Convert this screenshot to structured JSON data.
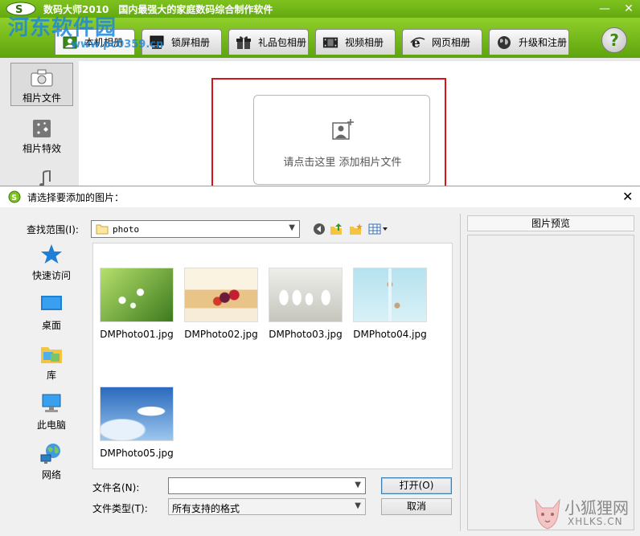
{
  "app": {
    "title": "数码大师2010　国内最强大的家庭数码综合制作软件",
    "minimize": "—",
    "close": "✕",
    "watermark": "河东软件园",
    "watermark_url": "www.pc0359.cn"
  },
  "tabs": [
    {
      "label": "本机相册",
      "icon": "photo-album-icon",
      "active": true
    },
    {
      "label": "锁屏相册",
      "icon": "monitor-icon"
    },
    {
      "label": "礼品包相册",
      "icon": "gift-icon"
    },
    {
      "label": "视频相册",
      "icon": "film-icon"
    },
    {
      "label": "网页相册",
      "icon": "ie-icon"
    },
    {
      "label": "升级和注册",
      "icon": "globe-icon"
    }
  ],
  "help_label": "?",
  "sidebar": [
    {
      "label": "相片文件",
      "icon": "camera-icon",
      "active": true
    },
    {
      "label": "相片特效",
      "icon": "effects-icon"
    }
  ],
  "add_card": {
    "text": "请点击这里  添加相片文件"
  },
  "dialog": {
    "title": "请选择要添加的图片：",
    "close": "✕",
    "look_in_label": "查找范围(I):",
    "look_in_value": "photo",
    "places": [
      {
        "label": "快速访问",
        "icon": "star-icon"
      },
      {
        "label": "桌面",
        "icon": "desktop-icon"
      },
      {
        "label": "库",
        "icon": "library-icon"
      },
      {
        "label": "此电脑",
        "icon": "computer-icon"
      },
      {
        "label": "网络",
        "icon": "network-icon"
      }
    ],
    "files": [
      {
        "name": "DMPhoto01.jpg",
        "colors": [
          "#8cc84a",
          "#3d7a1e"
        ]
      },
      {
        "name": "DMPhoto02.jpg",
        "colors": [
          "#f3e4c4",
          "#b02a3a"
        ]
      },
      {
        "name": "DMPhoto03.jpg",
        "colors": [
          "#e6e6e2",
          "#b8b8b0"
        ]
      },
      {
        "name": "DMPhoto04.jpg",
        "colors": [
          "#9fd6e6",
          "#d9f1f7"
        ]
      },
      {
        "name": "DMPhoto05.jpg",
        "colors": [
          "#2f6fc1",
          "#cfe3f7"
        ]
      }
    ],
    "preview_label": "图片预览",
    "filename_label": "文件名(N):",
    "filename_value": "",
    "filetype_label": "文件类型(T):",
    "filetype_value": "所有支持的格式",
    "open_button": "打开(O)",
    "cancel_button": "取消"
  },
  "corner_watermark": {
    "line1": "小狐狸网",
    "line2": "XHLKS.CN"
  }
}
